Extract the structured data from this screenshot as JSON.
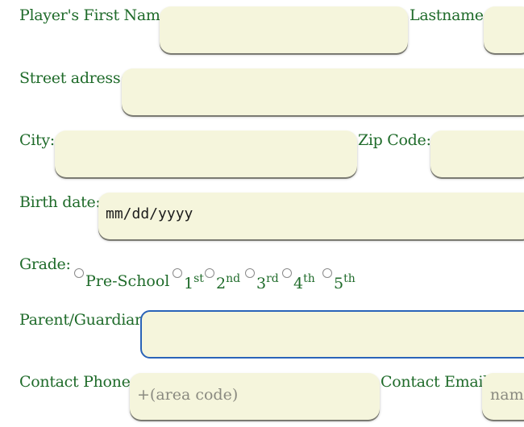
{
  "form": {
    "first_name_label": "Player's First Name:",
    "last_name_label": "Lastname:",
    "street_label": "Street adress:",
    "city_label": "City:",
    "zip_label": "Zip Code:",
    "birth_label": "Birth date:",
    "birth_value": "mm/dd/yyyy",
    "grade_label": "Grade:",
    "grades": [
      {
        "main": "Pre-School",
        "sup": ""
      },
      {
        "main": "1",
        "sup": "st"
      },
      {
        "main": "2",
        "sup": "nd"
      },
      {
        "main": "3",
        "sup": "rd"
      },
      {
        "main": "4",
        "sup": "th"
      },
      {
        "main": "5",
        "sup": "th"
      }
    ],
    "parent_label": "Parent/Guardian",
    "phone_label": "Contact Phone",
    "phone_placeholder": "+(area code)",
    "email_label": "Contact Email",
    "email_placeholder": "name"
  },
  "colors": {
    "label_green": "#1f6b2a",
    "field_bg": "#f5f5dc",
    "focus_border": "#2a63b8"
  }
}
